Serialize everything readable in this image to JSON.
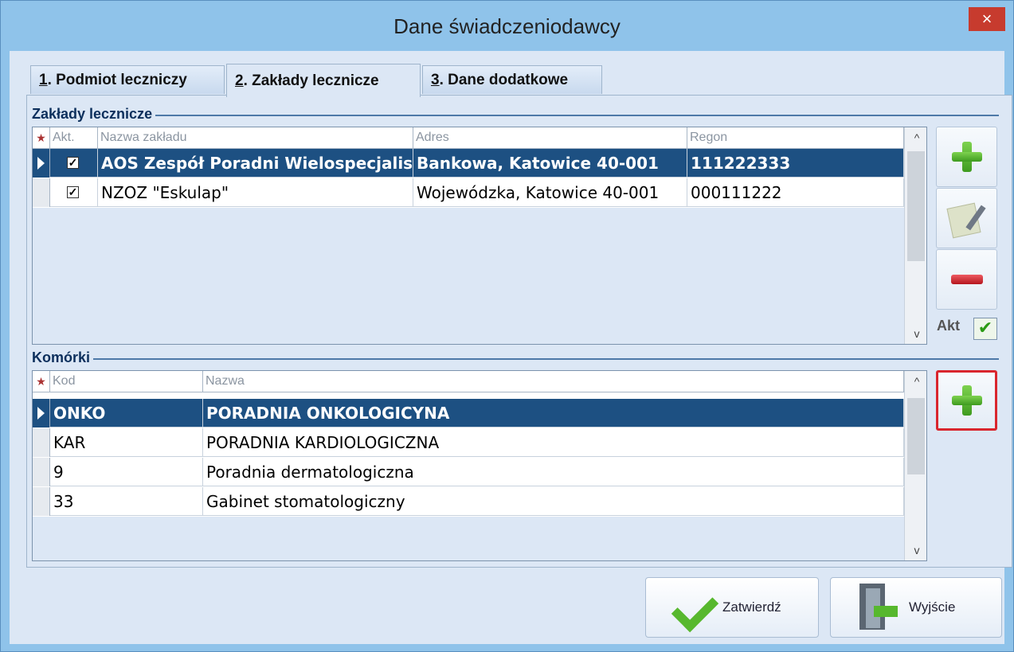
{
  "window": {
    "title": "Dane świadczeniodawcy",
    "close_glyph": "×"
  },
  "tabs": [
    {
      "num": "1",
      "label": ". Podmiot leczniczy"
    },
    {
      "num": "2",
      "label": ". Zakłady lecznicze"
    },
    {
      "num": "3",
      "label": ". Dane dodatkowe"
    }
  ],
  "active_tab_index": 1,
  "zaklady": {
    "group_label": "Zakłady lecznicze",
    "star": "★",
    "columns": [
      "Akt.",
      "Nazwa zakładu",
      "Adres",
      "Regon"
    ],
    "rows": [
      {
        "akt": true,
        "name": "AOS Zespół Poradni Wielospecjalistycznych",
        "address": "Bankowa, Katowice 40-001",
        "regon": "111222333",
        "selected": true
      },
      {
        "akt": true,
        "name": "NZOZ \"Eskulap\"",
        "address": "Wojewódzka, Katowice 40-001",
        "regon": "000111222",
        "selected": false
      }
    ],
    "akt_filter_label": "Akt",
    "akt_filter_glyph": "✔"
  },
  "komorki": {
    "group_label": "Komórki",
    "star": "★",
    "columns": [
      "Kod",
      "Nazwa"
    ],
    "rows": [
      {
        "code": "ONKO",
        "name": "PORADNIA ONKOLOGICYNA",
        "selected": true
      },
      {
        "code": "KAR",
        "name": "PORADNIA KARDIOLOGICZNA",
        "selected": false
      },
      {
        "code": "9",
        "name": "Poradnia dermatologiczna",
        "selected": false
      },
      {
        "code": "33",
        "name": "Gabinet stomatologiczny",
        "selected": false
      }
    ]
  },
  "scroll_glyphs": {
    "up": "^",
    "down": "v"
  },
  "icons": {
    "add": "plus-icon",
    "edit": "edit-document-icon",
    "remove": "minus-icon",
    "confirm": "checkmark-icon",
    "exit": "exit-door-icon"
  },
  "buttons": {
    "confirm": "Zatwierdź",
    "exit": "Wyjście"
  }
}
